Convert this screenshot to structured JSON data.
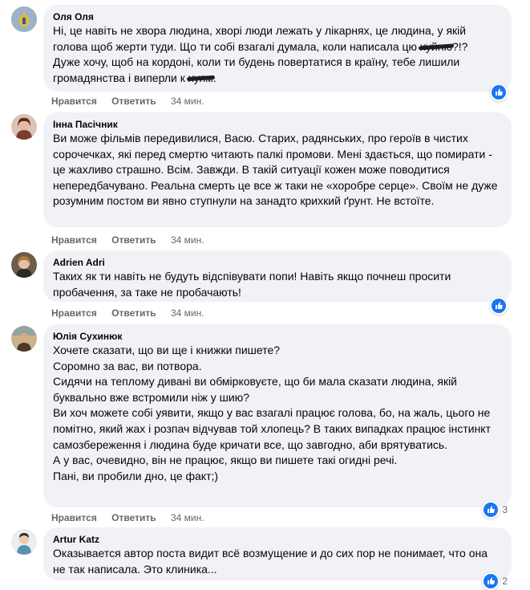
{
  "actions": {
    "like": "Нравится",
    "reply": "Ответить"
  },
  "comments": [
    {
      "author": "Оля Оля",
      "avatar": "avatar-olya",
      "text": "Ні, це навіть не хвора людина, хворі люди лежать у лікарнях, це людина, у якій голова щоб жерти туди. Що ти собі взагалі думала, коли написала цю хуйню?!?\nДуже хочу, щоб на кордоні, коли ти будень повертатися в країну, тебе лишили громадянства і виперли к хуям.",
      "time": "34 мин.",
      "reactions": ""
    },
    {
      "author": "Інна Пасічник",
      "avatar": "avatar-inna",
      "text": "Ви може фільмів передивилися, Васю. Старих, радянських, про героїв в чистих сорочечках, які перед смертю читають палкі промови. Мені здається, що помирати - це жахливо страшно. Всім. Завжди. В такій ситуації кожен може поводитися непередбачувано. Реальна смерть це все ж таки не «хоробре серце». Своїм не дуже розумним постом ви явно ступнули на занадто крихкий ґрунт. Не встоїте.",
      "time": "34 мин.",
      "reactions": ""
    },
    {
      "author": "Adrien Adri",
      "avatar": "avatar-adrien",
      "text": "Таких як ти навіть не будуть відспівувати попи! Навіть якщо почнеш просити пробачення, за таке не пробачають!",
      "time": "34 мин.",
      "reactions": ""
    },
    {
      "author": "Юлія Сухинюк",
      "avatar": "avatar-yulia",
      "text": "Хочете сказати, що ви ще і книжки пишете?\nСоромно за вас, ви потвора.\nСидячи на теплому дивані ви обмірковуєте, що би мала сказати людина, якій буквально вже встромили ніж у шию?\nВи хоч можете собі уявити, якщо у вас взагалі працює голова, бо, на жаль, цього не помітно, який жах і розпач відчував той хлопець? В таких випадках працює інстинкт самозбереження і людина буде кричати все, що завгодно, аби врятуватись.\nА у вас, очевидно, він не працює, якщо ви пишете такі огидні речі.\nПані, ви пробили дно, це факт;)",
      "time": "34 мин.",
      "reactions": "3"
    },
    {
      "author": "Artur Katz",
      "avatar": "avatar-artur",
      "text": "Оказывается автор поста видит всё возмущение и до сих пор не понимает, что она не так написала. Это клиника...",
      "time": "",
      "reactions": "2"
    }
  ]
}
